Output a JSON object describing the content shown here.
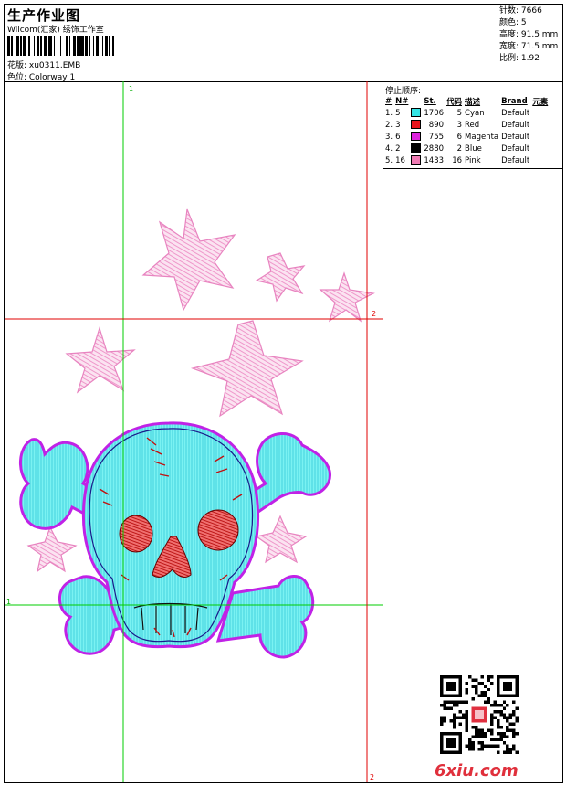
{
  "header": {
    "title": "生产作业图",
    "company": "Wilcom(汇家) 绣饰工作室",
    "design_label": "花版: xu0311.EMB",
    "colorway_label": "色位: Colorway 1"
  },
  "stats": [
    "针数: 7666",
    "颜色: 5",
    "高度: 91.5 mm",
    "宽度: 71.5 mm",
    "比例: 1.92"
  ],
  "stop_sequence": {
    "title": "停止顺序:",
    "headers": [
      "#",
      "N#",
      "St.",
      "代码",
      "描述",
      "Brand",
      "元素"
    ],
    "rows": [
      {
        "idx": "1.",
        "n": "5",
        "st": "1706",
        "code": "5",
        "desc": "Cyan",
        "brand": "Default",
        "color": "#33e5e5"
      },
      {
        "idx": "2.",
        "n": "3",
        "st": "890",
        "code": "3",
        "desc": "Red",
        "brand": "Default",
        "color": "#e8141c"
      },
      {
        "idx": "3.",
        "n": "6",
        "st": "755",
        "code": "6",
        "desc": "Magenta",
        "brand": "Default",
        "color": "#dd22dd"
      },
      {
        "idx": "4.",
        "n": "2",
        "st": "2880",
        "code": "2",
        "desc": "Blue",
        "brand": "Default",
        "color": "#000000"
      },
      {
        "idx": "5.",
        "n": "16",
        "st": "1433",
        "code": "16",
        "desc": "Pink",
        "brand": "Default",
        "color": "#f07ab4"
      }
    ]
  },
  "guides": {
    "green_label": "1",
    "red_label": "2"
  },
  "watermark": "6xiu.com",
  "colors": {
    "guide_green": "#00cc00",
    "guide_red": "#e00000",
    "cyan": "#6ef0f0",
    "pink": "#f29ad0",
    "red": "#d81818",
    "magenta": "#cc22ee"
  }
}
